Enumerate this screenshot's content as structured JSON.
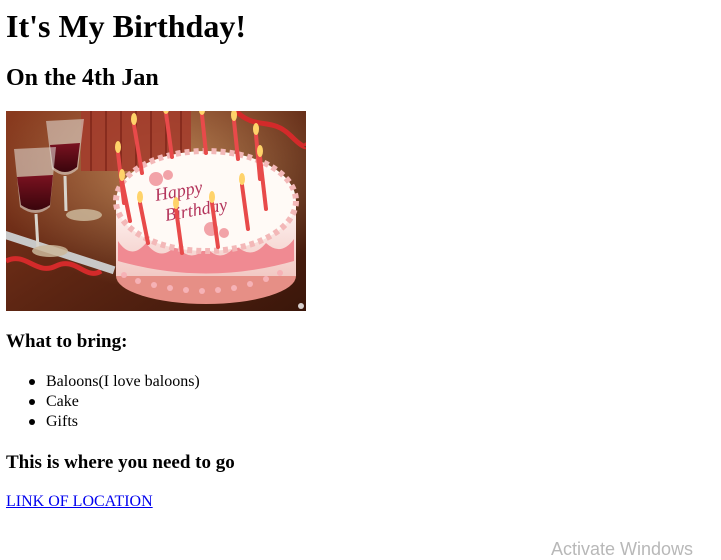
{
  "page": {
    "title": "It's My Birthday!",
    "subtitle": "On the 4th Jan",
    "image": {
      "caption_on_cake_line1": "Happy",
      "caption_on_cake_line2": "Birthday"
    },
    "bring_heading": "What to bring:",
    "bring_items": [
      "Baloons(I love baloons)",
      "Cake",
      "Gifts"
    ],
    "location_heading": "This is where you need to go",
    "location_link_text": "LINK OF LOCATION"
  },
  "os_overlay": {
    "watermark_text": "Activate Windows"
  },
  "colors": {
    "link": "#0000ee",
    "text": "#000000",
    "background": "#ffffff"
  }
}
